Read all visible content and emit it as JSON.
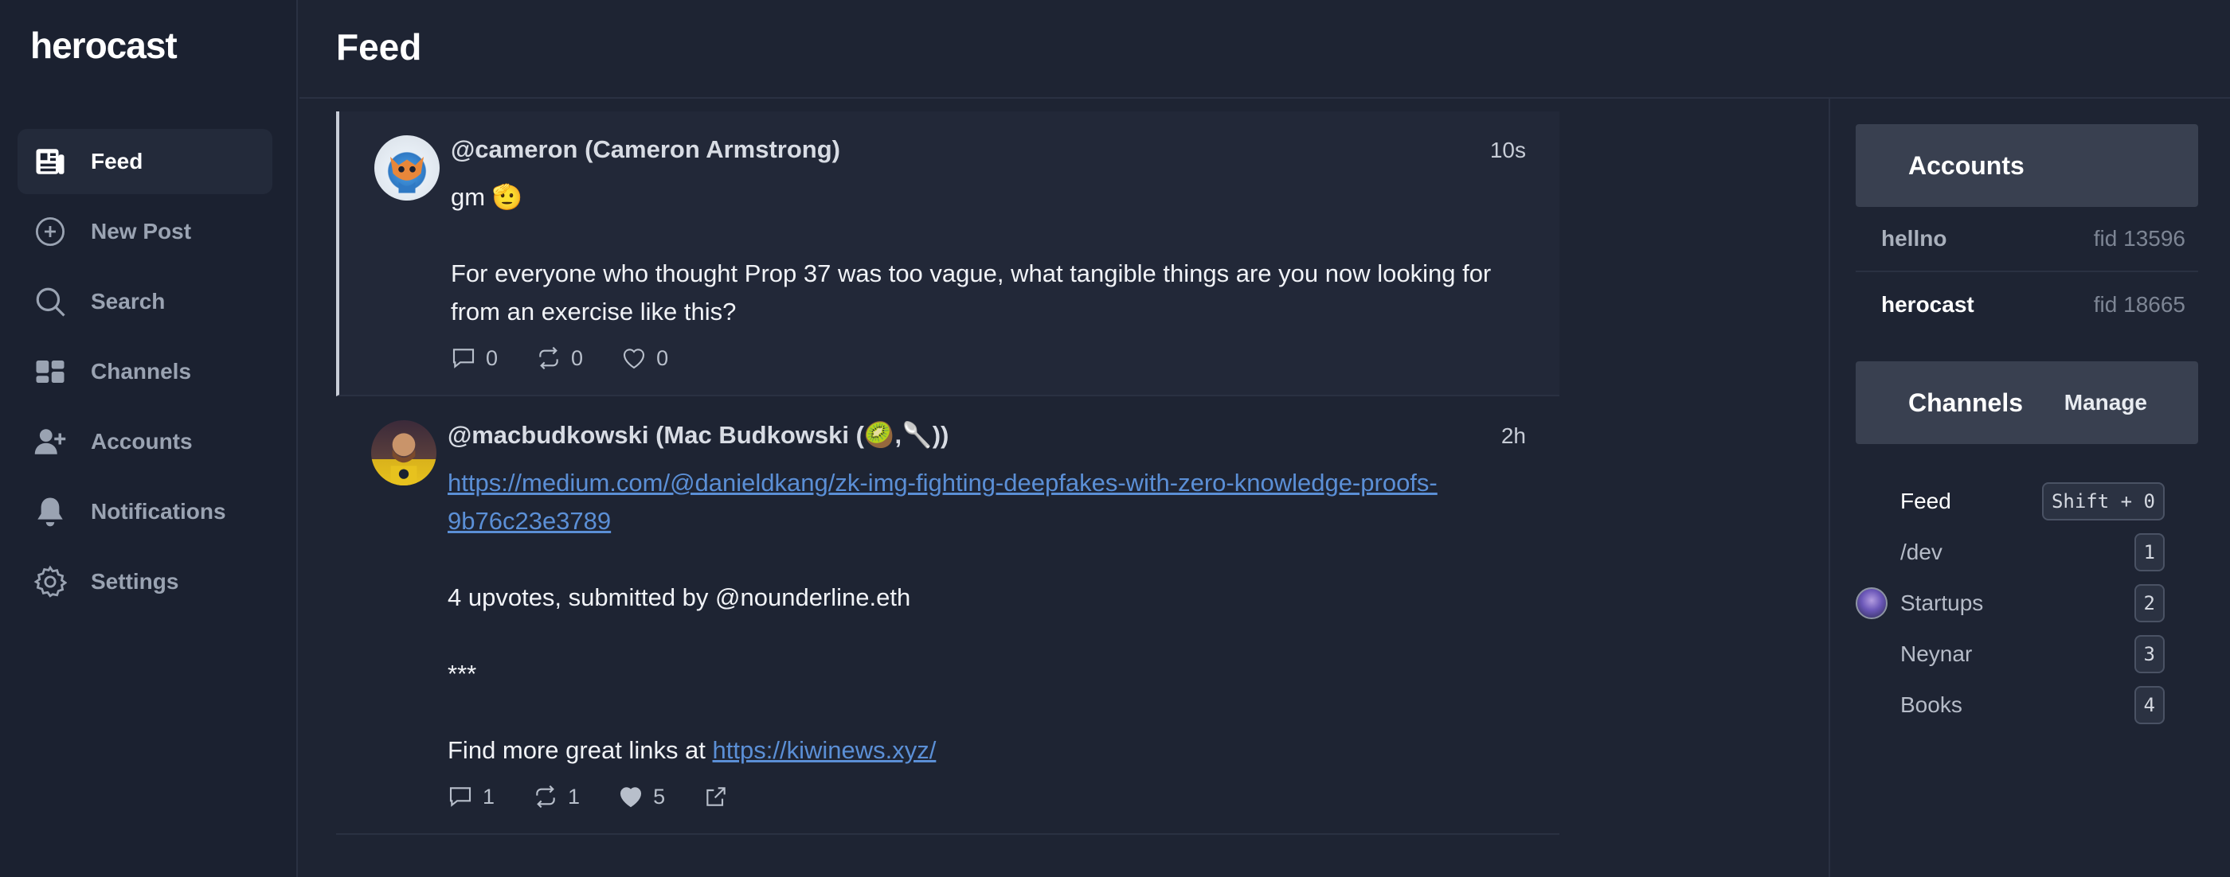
{
  "app": {
    "name": "herocast"
  },
  "sidebar": {
    "items": [
      {
        "label": "Feed",
        "icon": "newspaper-icon",
        "active": true
      },
      {
        "label": "New Post",
        "icon": "plus-circle-icon"
      },
      {
        "label": "Search",
        "icon": "search-icon"
      },
      {
        "label": "Channels",
        "icon": "rectangle-group-icon"
      },
      {
        "label": "Accounts",
        "icon": "user-plus-icon"
      },
      {
        "label": "Notifications",
        "icon": "bell-icon"
      },
      {
        "label": "Settings",
        "icon": "gear-icon"
      }
    ]
  },
  "header": {
    "title": "Feed"
  },
  "feed": {
    "casts": [
      {
        "author": "@cameron (Cameron Armstrong)",
        "age": "10s",
        "line1": "gm 🫡",
        "line2": "For everyone who thought Prop 37 was too vague, what tangible things are you now looking for from an exercise like this?",
        "replies": "0",
        "recasts": "0",
        "likes": "0"
      },
      {
        "author": "@macbudkowski (Mac Budkowski (🥝,🥄))",
        "age": "2h",
        "link1": "https://medium.com/@danieldkang/zk-img-fighting-deepfakes-with-zero-knowledge-proofs-9b76c23e3789",
        "line2": "4 upvotes, submitted by @nounderline.eth",
        "line3": "***",
        "line4_prefix": "Find more great links at ",
        "link2": "https://kiwinews.xyz/",
        "replies": "1",
        "recasts": "1",
        "likes": "5"
      }
    ]
  },
  "right_panel": {
    "accounts": {
      "title": "Accounts",
      "items": [
        {
          "name": "hellno",
          "fid": "fid 13596"
        },
        {
          "name": "herocast",
          "fid": "fid 18665",
          "current": true
        }
      ]
    },
    "channels": {
      "title": "Channels",
      "manage_label": "Manage",
      "items": [
        {
          "name": "Feed",
          "shortcut": "Shift + 0",
          "active": true
        },
        {
          "name": "/dev",
          "shortcut": "1"
        },
        {
          "name": "Startups",
          "shortcut": "2",
          "has_icon": true
        },
        {
          "name": "Neynar",
          "shortcut": "3"
        },
        {
          "name": "Books",
          "shortcut": "4"
        }
      ]
    }
  },
  "colors": {
    "background": "#1e2433",
    "sidebar": "#1b2130",
    "link": "#5b8fd6",
    "panel_header": "#394050"
  }
}
